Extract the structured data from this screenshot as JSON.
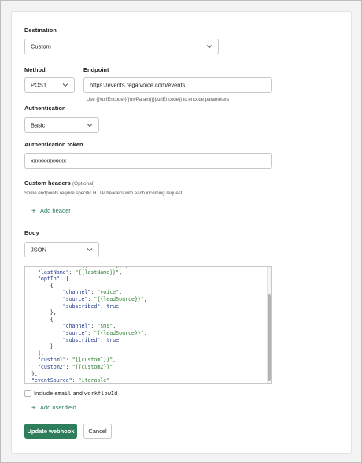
{
  "form": {
    "destination": {
      "label": "Destination",
      "value": "Custom"
    },
    "method": {
      "label": "Method",
      "value": "POST"
    },
    "endpoint": {
      "label": "Endpoint",
      "value": "https://events.regalvoice.com/events",
      "help": "Use {{#urlEncode}}{{myParam}}{{/urlEncode}} to encode parameters"
    },
    "authentication": {
      "label": "Authentication",
      "value": "Basic"
    },
    "auth_token": {
      "label": "Authentication token",
      "value": "xxxxxxxxxxxx"
    },
    "custom_headers": {
      "label": "Custom headers",
      "optional": "(Optional)",
      "help": "Some endpoints require specific HTTP headers with each incoming request.",
      "add_label": "Add header"
    },
    "body": {
      "label": "Body",
      "format": "JSON",
      "code_lines": [
        [
          {
            "t": "    ",
            "c": ""
          },
          {
            "t": "\"firstName\"",
            "c": "k"
          },
          {
            "t": ": ",
            "c": ""
          },
          {
            "t": "\"{{firstName}}\"",
            "c": "s"
          },
          {
            "t": ",",
            "c": ""
          }
        ],
        [
          {
            "t": "    ",
            "c": ""
          },
          {
            "t": "\"lastName\"",
            "c": "k"
          },
          {
            "t": ": ",
            "c": ""
          },
          {
            "t": "\"{{lastName}}\"",
            "c": "s"
          },
          {
            "t": ",",
            "c": ""
          }
        ],
        [
          {
            "t": "    ",
            "c": ""
          },
          {
            "t": "\"optIn\"",
            "c": "k"
          },
          {
            "t": ": [",
            "c": ""
          }
        ],
        [
          {
            "t": "        {",
            "c": ""
          }
        ],
        [
          {
            "t": "            ",
            "c": ""
          },
          {
            "t": "\"channel\"",
            "c": "k"
          },
          {
            "t": ": ",
            "c": ""
          },
          {
            "t": "\"voice\"",
            "c": "s"
          },
          {
            "t": ",",
            "c": ""
          }
        ],
        [
          {
            "t": "            ",
            "c": ""
          },
          {
            "t": "\"source\"",
            "c": "k"
          },
          {
            "t": ": ",
            "c": ""
          },
          {
            "t": "\"{{leadSource}}\"",
            "c": "s"
          },
          {
            "t": ",",
            "c": ""
          }
        ],
        [
          {
            "t": "            ",
            "c": ""
          },
          {
            "t": "\"subscribed\"",
            "c": "k"
          },
          {
            "t": ": ",
            "c": ""
          },
          {
            "t": "true",
            "c": "b"
          }
        ],
        [
          {
            "t": "        },",
            "c": ""
          }
        ],
        [
          {
            "t": "        {",
            "c": ""
          }
        ],
        [
          {
            "t": "            ",
            "c": ""
          },
          {
            "t": "\"channel\"",
            "c": "k"
          },
          {
            "t": ": ",
            "c": ""
          },
          {
            "t": "\"sms\"",
            "c": "s"
          },
          {
            "t": ",",
            "c": ""
          }
        ],
        [
          {
            "t": "            ",
            "c": ""
          },
          {
            "t": "\"source\"",
            "c": "k"
          },
          {
            "t": ": ",
            "c": ""
          },
          {
            "t": "\"{{leadSource}}\"",
            "c": "s"
          },
          {
            "t": ",",
            "c": ""
          }
        ],
        [
          {
            "t": "            ",
            "c": ""
          },
          {
            "t": "\"subscribed\"",
            "c": "k"
          },
          {
            "t": ": ",
            "c": ""
          },
          {
            "t": "true",
            "c": "b"
          }
        ],
        [
          {
            "t": "        }",
            "c": ""
          }
        ],
        [
          {
            "t": "    ],",
            "c": ""
          }
        ],
        [
          {
            "t": "    ",
            "c": ""
          },
          {
            "t": "\"custom1\"",
            "c": "k"
          },
          {
            "t": ": ",
            "c": ""
          },
          {
            "t": "\"{{custom1}}\"",
            "c": "s"
          },
          {
            "t": ",",
            "c": ""
          }
        ],
        [
          {
            "t": "    ",
            "c": ""
          },
          {
            "t": "\"custom2\"",
            "c": "k"
          },
          {
            "t": ": ",
            "c": ""
          },
          {
            "t": "\"{{custom2}}\"",
            "c": "s"
          }
        ],
        [
          {
            "t": "  },",
            "c": ""
          }
        ],
        [
          {
            "t": "  ",
            "c": ""
          },
          {
            "t": "\"eventSource\"",
            "c": "k"
          },
          {
            "t": ": ",
            "c": ""
          },
          {
            "t": "\"iterable\"",
            "c": "s"
          }
        ],
        [
          {
            "t": "}",
            "c": ""
          }
        ]
      ]
    },
    "include": {
      "prefix": "Include",
      "code1": "email",
      "and": "and",
      "code2": "workflowId"
    },
    "add_user_field": "Add user field",
    "submit_label": "Update webhook",
    "cancel_label": "Cancel"
  },
  "colors": {
    "accent": "#2e7d5b",
    "json_key": "#1e3a8a",
    "json_string": "#2e7d32"
  },
  "icons": {
    "dropdown": "chevron-down-icon",
    "add": "plus-icon"
  }
}
